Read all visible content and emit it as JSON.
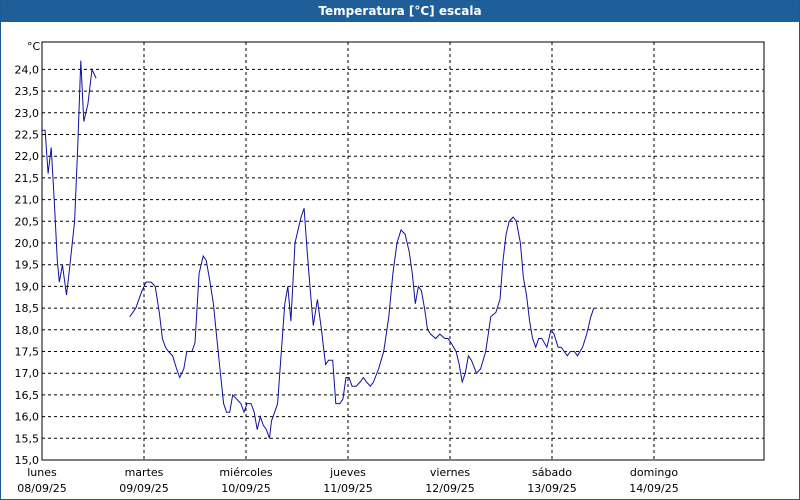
{
  "chart_data": {
    "type": "line",
    "title": "Temperatura [°C] escala",
    "ylabel": "°C",
    "ylim": [
      15.0,
      24.5
    ],
    "yticks": [
      "15,0",
      "15,5",
      "16,0",
      "16,5",
      "17,0",
      "17,5",
      "18,0",
      "18,5",
      "19,0",
      "19,5",
      "20,0",
      "20,5",
      "21,0",
      "21,5",
      "22,0",
      "22,5",
      "23,0",
      "23,5",
      "24,0"
    ],
    "xlim": [
      0,
      7
    ],
    "xticks": [
      {
        "day": "lunes",
        "date": "08/09/25"
      },
      {
        "day": "martes",
        "date": "09/09/25"
      },
      {
        "day": "miércoles",
        "date": "10/09/25"
      },
      {
        "day": "jueves",
        "date": "11/09/25"
      },
      {
        "day": "viernes",
        "date": "12/09/25"
      },
      {
        "day": "sábado",
        "date": "13/09/25"
      },
      {
        "day": "domingo",
        "date": "14/09/25"
      }
    ],
    "grid": true,
    "line_color": "#1010a0",
    "series": [
      {
        "segments": [
          [
            [
              0.0,
              22.6
            ],
            [
              0.03,
              22.6
            ],
            [
              0.06,
              21.6
            ],
            [
              0.09,
              22.2
            ],
            [
              0.12,
              21.0
            ],
            [
              0.15,
              19.6
            ],
            [
              0.17,
              19.1
            ],
            [
              0.2,
              19.5
            ],
            [
              0.24,
              18.8
            ],
            [
              0.27,
              19.4
            ],
            [
              0.32,
              20.5
            ],
            [
              0.35,
              22.2
            ],
            [
              0.38,
              24.2
            ],
            [
              0.41,
              22.8
            ],
            [
              0.45,
              23.2
            ],
            [
              0.49,
              24.0
            ],
            [
              0.53,
              23.8
            ]
          ],
          [
            [
              0.86,
              18.3
            ],
            [
              0.92,
              18.5
            ],
            [
              0.98,
              18.9
            ],
            [
              1.02,
              19.1
            ],
            [
              1.07,
              19.1
            ],
            [
              1.11,
              19.0
            ],
            [
              1.15,
              18.4
            ],
            [
              1.18,
              17.8
            ],
            [
              1.21,
              17.6
            ],
            [
              1.24,
              17.5
            ],
            [
              1.28,
              17.4
            ],
            [
              1.32,
              17.1
            ],
            [
              1.35,
              16.9
            ],
            [
              1.39,
              17.1
            ],
            [
              1.42,
              17.5
            ],
            [
              1.47,
              17.5
            ],
            [
              1.5,
              17.7
            ],
            [
              1.54,
              19.3
            ],
            [
              1.58,
              19.7
            ],
            [
              1.61,
              19.6
            ],
            [
              1.64,
              19.2
            ],
            [
              1.68,
              18.6
            ],
            [
              1.71,
              17.9
            ],
            [
              1.74,
              17.2
            ],
            [
              1.78,
              16.3
            ],
            [
              1.81,
              16.1
            ],
            [
              1.84,
              16.1
            ],
            [
              1.87,
              16.5
            ],
            [
              1.91,
              16.4
            ],
            [
              1.95,
              16.3
            ],
            [
              1.98,
              16.1
            ],
            [
              2.01,
              16.3
            ],
            [
              2.05,
              16.3
            ],
            [
              2.08,
              16.1
            ],
            [
              2.11,
              15.7
            ],
            [
              2.14,
              16.0
            ],
            [
              2.17,
              15.8
            ],
            [
              2.2,
              15.7
            ],
            [
              2.23,
              15.5
            ],
            [
              2.25,
              15.9
            ],
            [
              2.28,
              16.1
            ],
            [
              2.31,
              16.3
            ],
            [
              2.34,
              17.3
            ],
            [
              2.38,
              18.6
            ],
            [
              2.41,
              19.0
            ],
            [
              2.44,
              18.2
            ],
            [
              2.48,
              20.0
            ],
            [
              2.51,
              20.3
            ],
            [
              2.54,
              20.6
            ],
            [
              2.57,
              20.8
            ],
            [
              2.6,
              19.8
            ],
            [
              2.63,
              18.9
            ],
            [
              2.66,
              18.1
            ],
            [
              2.7,
              18.7
            ],
            [
              2.74,
              18.0
            ],
            [
              2.76,
              17.6
            ],
            [
              2.78,
              17.2
            ],
            [
              2.81,
              17.3
            ],
            [
              2.85,
              17.3
            ],
            [
              2.88,
              16.3
            ],
            [
              2.92,
              16.3
            ],
            [
              2.95,
              16.4
            ],
            [
              2.98,
              16.9
            ],
            [
              3.01,
              16.9
            ],
            [
              3.04,
              16.7
            ],
            [
              3.08,
              16.7
            ],
            [
              3.12,
              16.8
            ],
            [
              3.15,
              16.9
            ],
            [
              3.18,
              16.8
            ],
            [
              3.22,
              16.7
            ],
            [
              3.25,
              16.8
            ],
            [
              3.3,
              17.1
            ],
            [
              3.35,
              17.5
            ],
            [
              3.4,
              18.3
            ],
            [
              3.44,
              19.3
            ],
            [
              3.48,
              20.0
            ],
            [
              3.52,
              20.3
            ],
            [
              3.56,
              20.2
            ],
            [
              3.6,
              19.8
            ],
            [
              3.63,
              19.3
            ],
            [
              3.66,
              18.6
            ],
            [
              3.69,
              19.0
            ],
            [
              3.72,
              18.9
            ],
            [
              3.75,
              18.5
            ],
            [
              3.78,
              18.0
            ],
            [
              3.81,
              17.9
            ],
            [
              3.86,
              17.8
            ],
            [
              3.9,
              17.9
            ],
            [
              3.95,
              17.8
            ],
            [
              3.98,
              17.8
            ],
            [
              4.01,
              17.7
            ],
            [
              4.06,
              17.5
            ],
            [
              4.09,
              17.2
            ],
            [
              4.12,
              16.8
            ],
            [
              4.15,
              17.0
            ],
            [
              4.18,
              17.4
            ],
            [
              4.21,
              17.3
            ],
            [
              4.26,
              17.0
            ],
            [
              4.3,
              17.1
            ],
            [
              4.35,
              17.5
            ],
            [
              4.4,
              18.3
            ],
            [
              4.45,
              18.4
            ],
            [
              4.49,
              18.7
            ],
            [
              4.52,
              19.6
            ],
            [
              4.55,
              20.2
            ],
            [
              4.58,
              20.5
            ],
            [
              4.62,
              20.6
            ],
            [
              4.65,
              20.5
            ],
            [
              4.69,
              20.0
            ],
            [
              4.72,
              19.2
            ],
            [
              4.75,
              18.8
            ],
            [
              4.78,
              18.2
            ],
            [
              4.81,
              17.8
            ],
            [
              4.84,
              17.6
            ],
            [
              4.87,
              17.8
            ],
            [
              4.9,
              17.8
            ],
            [
              4.95,
              17.6
            ],
            [
              4.99,
              18.0
            ],
            [
              5.02,
              17.9
            ],
            [
              5.06,
              17.6
            ],
            [
              5.09,
              17.6
            ],
            [
              5.12,
              17.5
            ],
            [
              5.15,
              17.4
            ],
            [
              5.18,
              17.5
            ],
            [
              5.22,
              17.5
            ],
            [
              5.25,
              17.4
            ],
            [
              5.3,
              17.6
            ],
            [
              5.34,
              17.9
            ],
            [
              5.38,
              18.3
            ],
            [
              5.41,
              18.5
            ]
          ]
        ]
      }
    ]
  }
}
